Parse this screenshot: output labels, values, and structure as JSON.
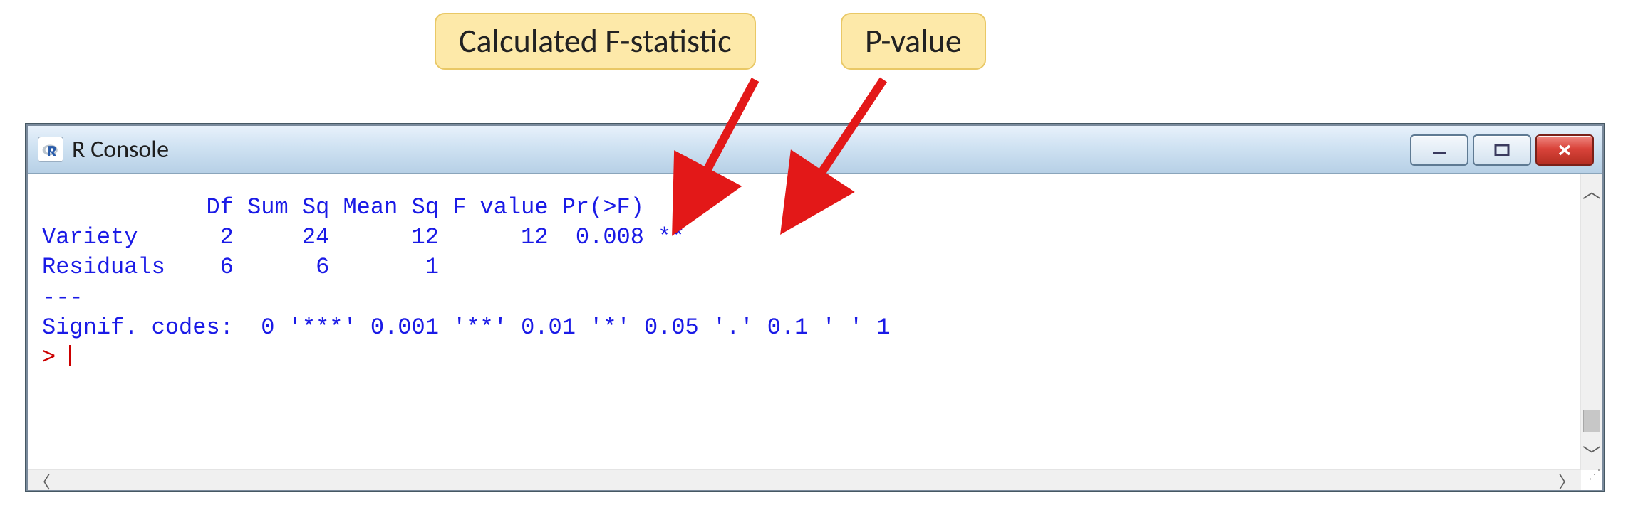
{
  "callouts": {
    "f_stat": "Calculated F-statistic",
    "p_value": "P-value"
  },
  "window": {
    "title": "R Console"
  },
  "console": {
    "header": "            Df Sum Sq Mean Sq F value Pr(>F)  ",
    "row1": "Variety      2     24      12      12  0.008 **",
    "row2": "Residuals    6      6       1                ",
    "divider": "---",
    "signif": "Signif. codes:  0 '***' 0.001 '**' 0.01 '*' 0.05 '.' 0.1 ' ' 1",
    "prompt": "> "
  }
}
